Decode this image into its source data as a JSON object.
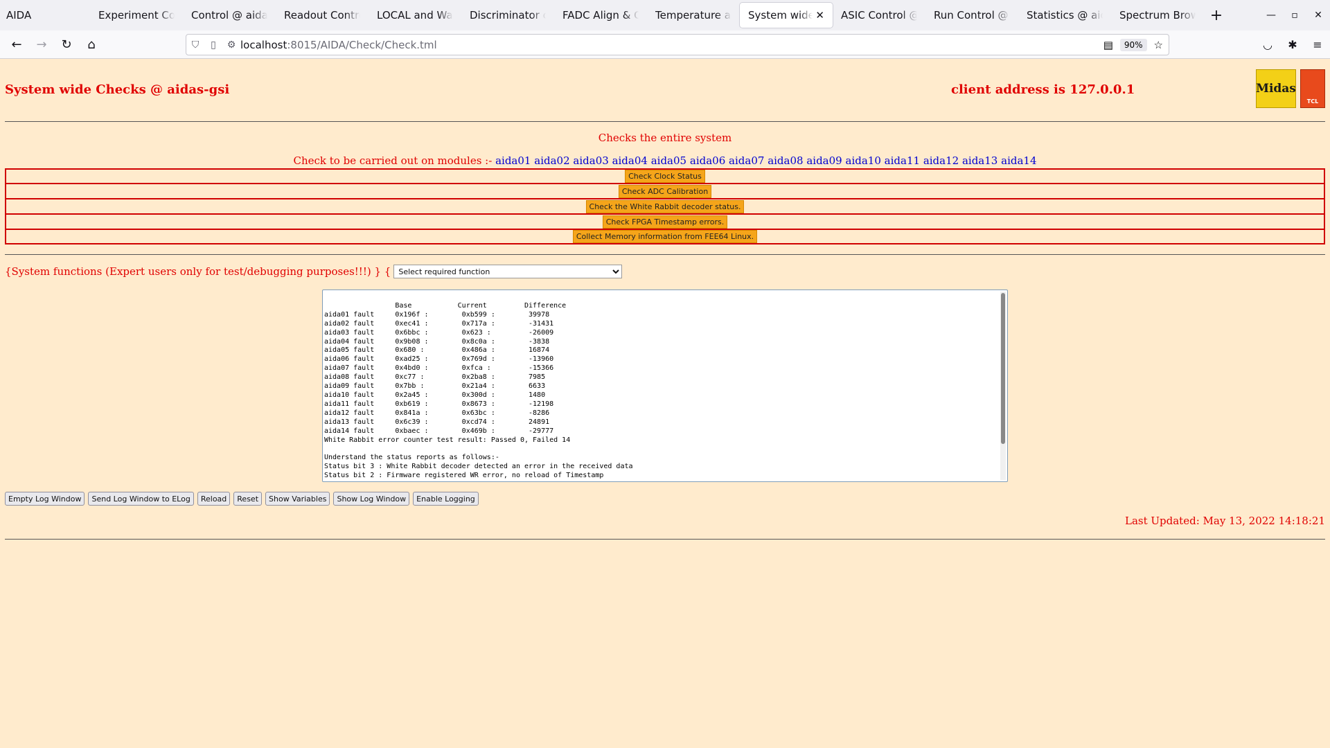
{
  "browser": {
    "app_name": "AIDA",
    "tabs": [
      {
        "label": "Experiment Control"
      },
      {
        "label": "Control @ aidas-gsi"
      },
      {
        "label": "Readout Control @"
      },
      {
        "label": "LOCAL and Wave"
      },
      {
        "label": "Discriminator con"
      },
      {
        "label": "FADC Align & Con"
      },
      {
        "label": "Temperature and"
      },
      {
        "label": "System wide Ch",
        "active": true
      },
      {
        "label": "ASIC Control @ ai"
      },
      {
        "label": "Run Control @ ai"
      },
      {
        "label": "Statistics @ aidas"
      },
      {
        "label": "Spectrum Browse"
      }
    ],
    "new_tab": "+",
    "url_host": "localhost",
    "url_rest": ":8015/AIDA/Check/Check.tml",
    "zoom": "90%"
  },
  "page": {
    "title": "System wide Checks @ aidas-gsi",
    "client": "client address is 127.0.0.1",
    "logo_midas": "Midas",
    "logo_tcl": "TCL",
    "subtitle": "Checks the entire system",
    "modules_label": "Check to be carried out on modules :-",
    "modules": [
      "aida01",
      "aida02",
      "aida03",
      "aida04",
      "aida05",
      "aida06",
      "aida07",
      "aida08",
      "aida09",
      "aida10",
      "aida11",
      "aida12",
      "aida13",
      "aida14"
    ],
    "checks": [
      "Check Clock Status",
      "Check ADC Calibration",
      "Check the White Rabbit decoder status.",
      "Check FPGA Timestamp errors.",
      "Collect Memory information from FEE64 Linux."
    ],
    "sysfunc_label": "{System functions (Expert users only for test/debugging purposes!!!)  } {",
    "sysfunc_select": "Select required function",
    "log_text": "\n                 Base           Current         Difference\naida01 fault     0x196f :        0xb599 :        39978\naida02 fault     0xec41 :        0x717a :        -31431\naida03 fault     0x6bbc :        0x623 :         -26009\naida04 fault     0x9b08 :        0x8c0a :        -3838\naida05 fault     0x680 :         0x486a :        16874\naida06 fault     0xad25 :        0x769d :        -13960\naida07 fault     0x4bd0 :        0xfca :         -15366\naida08 fault     0xc77 :         0x2ba8 :        7985\naida09 fault     0x7bb :         0x21a4 :        6633\naida10 fault     0x2a45 :        0x300d :        1480\naida11 fault     0xb619 :        0x8673 :        -12198\naida12 fault     0x841a :        0x63bc :        -8286\naida13 fault     0x6c39 :        0xcd74 :        24891\naida14 fault     0xbaec :        0x469b :        -29777\nWhite Rabbit error counter test result: Passed 0, Failed 14\n\nUnderstand the status reports as follows:-\nStatus bit 3 : White Rabbit decoder detected an error in the received data\nStatus bit 2 : Firmware registered WR error, no reload of Timestamp",
    "buttons": [
      "Empty Log Window",
      "Send Log Window to ELog",
      "Reload",
      "Reset",
      "Show Variables",
      "Show Log Window",
      "Enable Logging"
    ],
    "last_updated": "Last Updated: May 13, 2022 14:18:21"
  }
}
